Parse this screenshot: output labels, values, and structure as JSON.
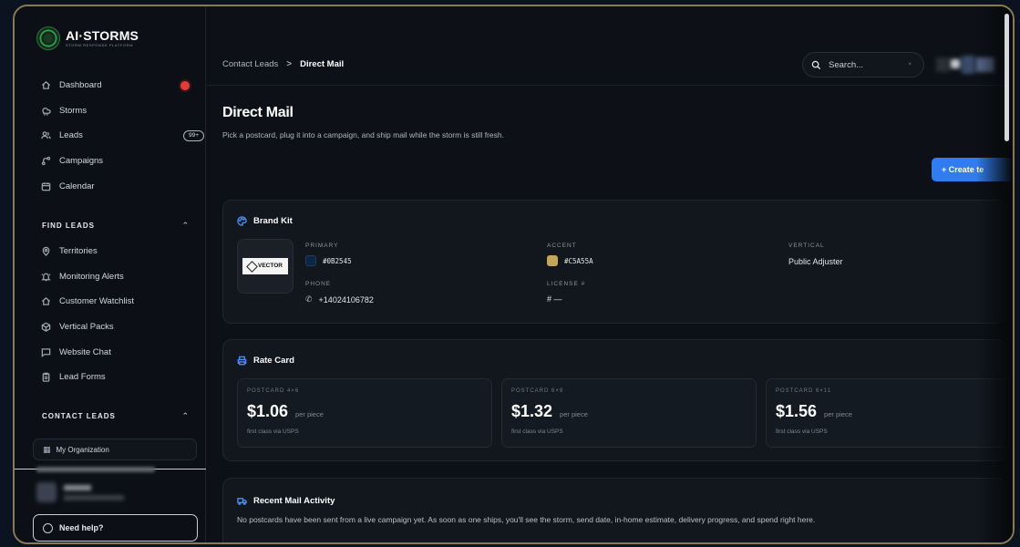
{
  "app": {
    "name": "AI·STORMS",
    "tagline": "STORM RESPONSE PLATFORM"
  },
  "sidebar": {
    "items": [
      {
        "label": "Dashboard",
        "icon": "home-icon",
        "indicator": "red-dot"
      },
      {
        "label": "Storms",
        "icon": "storm-icon"
      },
      {
        "label": "Leads",
        "icon": "users-icon",
        "badge": "99+"
      },
      {
        "label": "Campaigns",
        "icon": "route-icon"
      },
      {
        "label": "Calendar",
        "icon": "calendar-icon"
      }
    ],
    "find_leads": {
      "heading": "FIND LEADS",
      "items": [
        {
          "label": "Territories",
          "icon": "map-pin-icon"
        },
        {
          "label": "Monitoring Alerts",
          "icon": "bell-icon"
        },
        {
          "label": "Customer Watchlist",
          "icon": "home-icon"
        },
        {
          "label": "Vertical Packs",
          "icon": "package-icon"
        },
        {
          "label": "Website Chat",
          "icon": "chat-icon"
        },
        {
          "label": "Lead Forms",
          "icon": "clipboard-icon"
        }
      ]
    },
    "contact_leads": {
      "heading": "CONTACT LEADS",
      "org": "My Organization"
    },
    "help_label": "Need help?"
  },
  "header": {
    "breadcrumb": {
      "parent": "Contact Leads",
      "separator": ">",
      "current": "Direct Mail"
    },
    "search_placeholder": "Search...",
    "search_clear": "×"
  },
  "page": {
    "title": "Direct Mail",
    "subtitle": "Pick a postcard, plug it into a campaign, and ship mail while the storm is still fresh.",
    "create_button": "+ Create te"
  },
  "brand_kit": {
    "title": "Brand Kit",
    "logo_text": "VECTOR",
    "primary_label": "PRIMARY",
    "primary_value": "#0B2545",
    "primary_color": "#0B2545",
    "accent_label": "ACCENT",
    "accent_value": "#C5A55A",
    "accent_color": "#C5A55A",
    "vertical_label": "VERTICAL",
    "vertical_value": "Public Adjuster",
    "phone_label": "PHONE",
    "phone_value": "+14024106782",
    "license_label": "LICENSE #",
    "license_value": "# —"
  },
  "rate_card": {
    "title": "Rate Card",
    "items": [
      {
        "label": "POSTCARD 4×6",
        "price": "$1.06",
        "unit": "per piece",
        "note": "first class via USPS"
      },
      {
        "label": "POSTCARD 6×9",
        "price": "$1.32",
        "unit": "per piece",
        "note": "first class via USPS"
      },
      {
        "label": "POSTCARD 6×11",
        "price": "$1.56",
        "unit": "per piece",
        "note": "first class via USPS"
      }
    ]
  },
  "activity": {
    "title": "Recent Mail Activity",
    "empty_text": "No postcards have been sent from a live campaign yet. As soon as one ships, you'll see the storm, send date, in-home estimate, delivery progress, and spend right here."
  },
  "colors": {
    "accent_blue": "#2f7df0",
    "frame_border": "#8a7a52",
    "alert_red": "#e23d3d"
  }
}
